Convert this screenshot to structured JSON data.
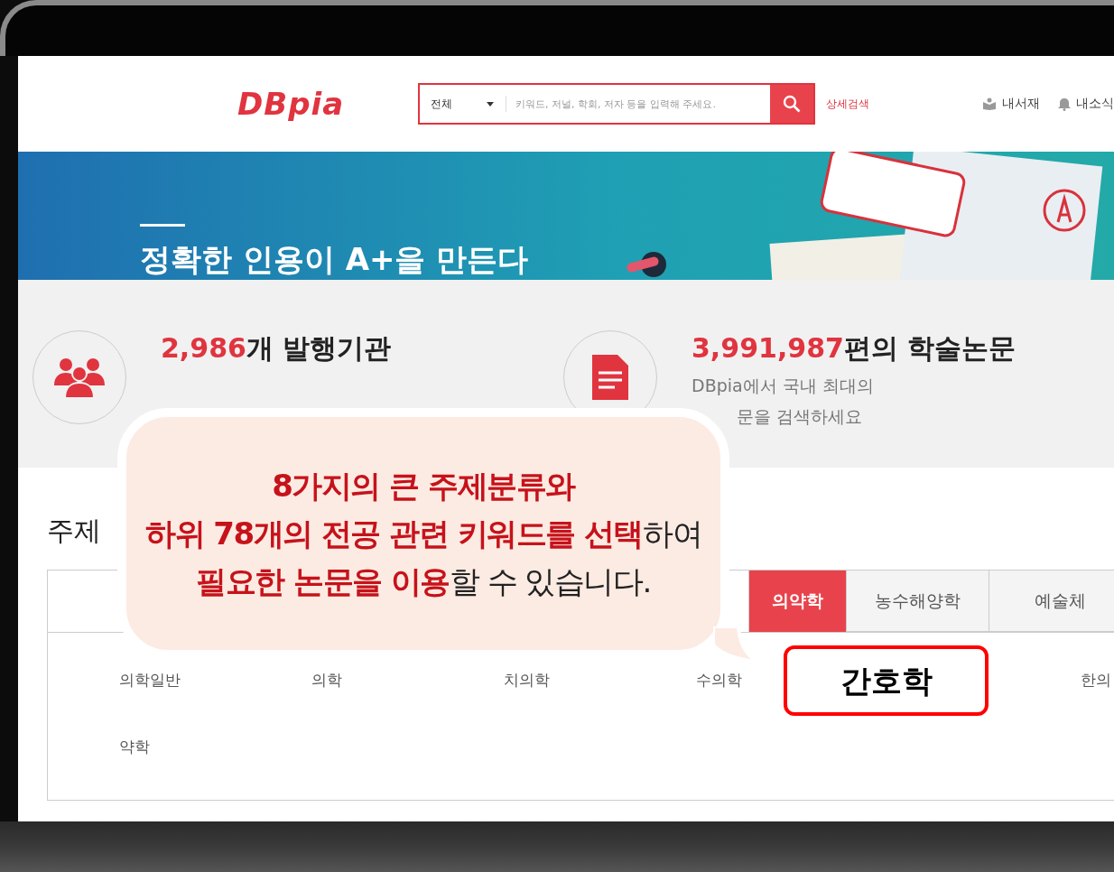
{
  "header": {
    "logo": "DBpia",
    "search": {
      "scope": "전체",
      "placeholder": "키워드, 저널, 학회, 저자 등을 입력해 주세요."
    },
    "advanced_link": "상세검색",
    "links": [
      {
        "kind": "library",
        "label": "내서재"
      },
      {
        "kind": "news",
        "label": "내소식"
      }
    ]
  },
  "banner": {
    "headline": "정확한 인용이 A+을 만든다"
  },
  "stats": [
    {
      "kind": "people",
      "number": "2,986",
      "label": "개 발행기관"
    },
    {
      "kind": "document",
      "number": "3,991,987",
      "label": "편의 학술논문",
      "lines": [
        "DBpia에서 국내 최대의",
        "문을 검색하세요"
      ]
    }
  ],
  "subject": {
    "title": "주제",
    "tabs": [
      {
        "label": "의약학",
        "selected": true
      },
      {
        "label": "농수해양학",
        "selected": false
      },
      {
        "label": "예술체",
        "selected": false
      }
    ],
    "items": [
      {
        "label": "의학일반",
        "highlighted": false
      },
      {
        "label": "의학",
        "highlighted": false
      },
      {
        "label": "치의학",
        "highlighted": false
      },
      {
        "label": "수의학",
        "highlighted": false
      },
      {
        "label": "간호학",
        "highlighted": true
      },
      {
        "label": "한의",
        "highlighted": false
      },
      {
        "label": "약학",
        "highlighted": false
      }
    ]
  },
  "callout": {
    "lines": [
      "**8가지의 큰 주제분류와**",
      "**하위 78개의 전공 관련 키워드를 선택**하여",
      "**필요한 논문을 이용**할 수 있습니다."
    ]
  }
}
